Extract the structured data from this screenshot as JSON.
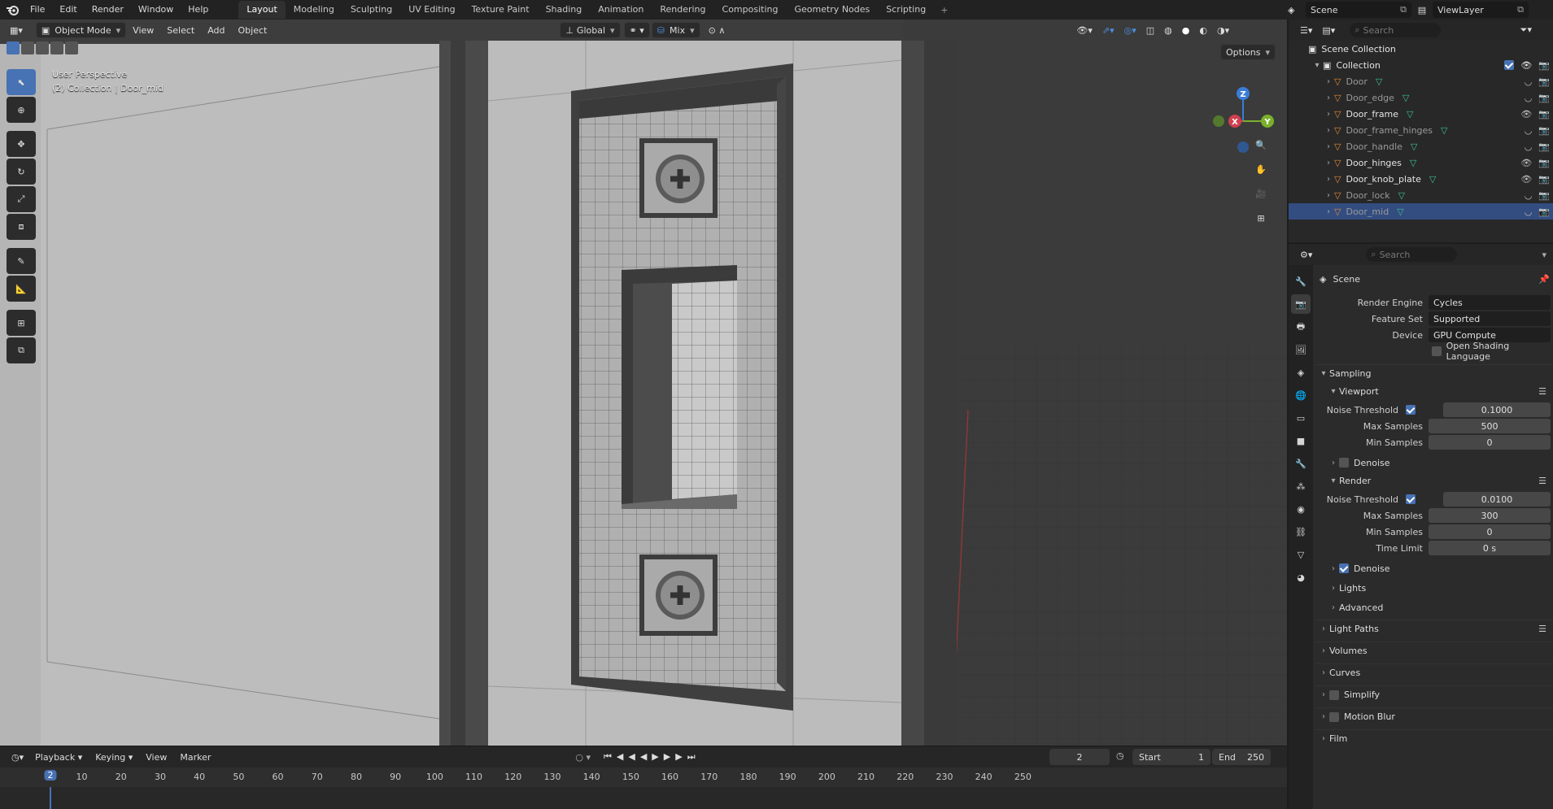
{
  "topbar": {
    "menus": [
      "File",
      "Edit",
      "Render",
      "Window",
      "Help"
    ],
    "tabs": [
      "Layout",
      "Modeling",
      "Sculpting",
      "UV Editing",
      "Texture Paint",
      "Shading",
      "Animation",
      "Rendering",
      "Compositing",
      "Geometry Nodes",
      "Scripting"
    ],
    "active_tab": "Layout",
    "scene_name": "Scene",
    "view_layer": "ViewLayer"
  },
  "viewport": {
    "mode": "Object Mode",
    "menus": [
      "View",
      "Select",
      "Add",
      "Object"
    ],
    "transform_orientation": "Global",
    "snap_mode": "Mix",
    "options_label": "Options",
    "perspective_label": "User Perspective",
    "collection_label": "(2) Collection | Door_mid",
    "gizmo_axes": {
      "x": "X",
      "y": "Y",
      "z": "Z"
    },
    "colors": {
      "x": "#d0404f",
      "y": "#7ab02c",
      "z": "#3a7dd6",
      "selection": "#4772b3"
    }
  },
  "timeline": {
    "menus": [
      "Playback",
      "Keying",
      "View",
      "Marker"
    ],
    "current_frame": "2",
    "start_label": "Start",
    "start_value": "1",
    "end_label": "End",
    "end_value": "250",
    "ruler": [
      "2",
      "10",
      "20",
      "30",
      "40",
      "50",
      "60",
      "70",
      "80",
      "90",
      "100",
      "110",
      "120",
      "130",
      "140",
      "150",
      "160",
      "170",
      "180",
      "190",
      "200",
      "210",
      "220",
      "230",
      "240",
      "250"
    ]
  },
  "outliner": {
    "search_placeholder": "Search",
    "scene_collection": "Scene Collection",
    "collection": "Collection",
    "items": [
      {
        "name": "Door",
        "bright": false
      },
      {
        "name": "Door_edge",
        "bright": false
      },
      {
        "name": "Door_frame",
        "bright": true
      },
      {
        "name": "Door_frame_hinges",
        "bright": false
      },
      {
        "name": "Door_handle",
        "bright": false
      },
      {
        "name": "Door_hinges",
        "bright": true
      },
      {
        "name": "Door_knob_plate",
        "bright": true
      },
      {
        "name": "Door_lock",
        "bright": false
      },
      {
        "name": "Door_mid",
        "bright": false,
        "selected": true
      }
    ]
  },
  "properties": {
    "search_placeholder": "Search",
    "context": "Scene",
    "render_engine_label": "Render Engine",
    "render_engine": "Cycles",
    "feature_set_label": "Feature Set",
    "feature_set": "Supported",
    "device_label": "Device",
    "device": "GPU Compute",
    "osl_label": "Open Shading Language",
    "sampling": "Sampling",
    "viewport": "Viewport",
    "noise_threshold_label": "Noise Threshold",
    "viewport_noise_threshold": "0.1000",
    "max_samples_label": "Max Samples",
    "viewport_max_samples": "500",
    "min_samples_label": "Min Samples",
    "viewport_min_samples": "0",
    "denoise": "Denoise",
    "render": "Render",
    "render_noise_threshold": "0.0100",
    "render_max_samples": "300",
    "render_min_samples": "0",
    "time_limit_label": "Time Limit",
    "time_limit": "0 s",
    "lights": "Lights",
    "advanced": "Advanced",
    "light_paths": "Light Paths",
    "volumes": "Volumes",
    "curves": "Curves",
    "simplify": "Simplify",
    "motion_blur": "Motion Blur",
    "film": "Film"
  }
}
